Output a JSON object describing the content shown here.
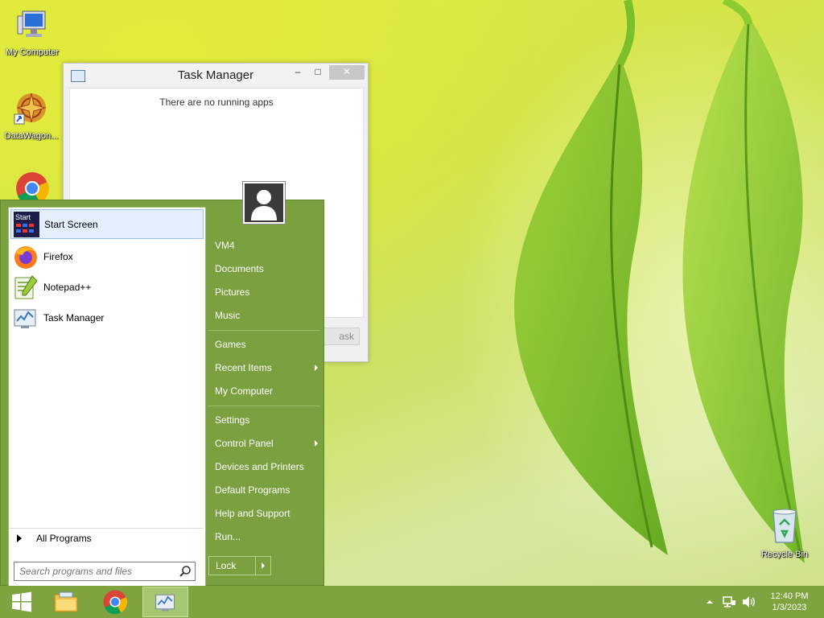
{
  "desktop": {
    "icons": [
      {
        "label": "My Computer",
        "icon": "my-computer-icon"
      },
      {
        "label": "DataWagon...",
        "icon": "datawagon-icon"
      },
      {
        "label": "Recycle Bin",
        "icon": "recycle-bin-icon"
      }
    ]
  },
  "task_manager": {
    "title": "Task Manager",
    "minimize": "–",
    "maximize": "□",
    "close": "✕",
    "empty_message": "There are no running apps",
    "end_task_label": "ask"
  },
  "start_menu": {
    "programs": [
      {
        "label": "Start Screen",
        "icon": "start-screen-icon",
        "badge": "Start"
      },
      {
        "label": "Firefox",
        "icon": "firefox-icon"
      },
      {
        "label": "Notepad++",
        "icon": "notepadpp-icon"
      },
      {
        "label": "Task Manager",
        "icon": "task-manager-icon"
      }
    ],
    "all_programs": "All Programs",
    "search_placeholder": "Search programs and files",
    "right_items": [
      {
        "label": "VM4"
      },
      {
        "label": "Documents"
      },
      {
        "label": "Pictures"
      },
      {
        "label": "Music"
      },
      {
        "label": "Games"
      },
      {
        "label": "Recent Items",
        "submenu": true
      },
      {
        "label": "My Computer"
      },
      {
        "label": "Settings"
      },
      {
        "label": "Control Panel",
        "submenu": true
      },
      {
        "label": "Devices and Printers"
      },
      {
        "label": "Default Programs"
      },
      {
        "label": "Help and Support"
      },
      {
        "label": "Run..."
      }
    ],
    "lock_label": "Lock"
  },
  "taskbar": {
    "buttons": [
      "windows-start-icon",
      "file-explorer-icon",
      "chrome-icon",
      "task-manager-icon"
    ],
    "tray_icons": [
      "show-hidden-icon",
      "network-icon",
      "volume-icon"
    ],
    "time": "12:40 PM",
    "date": "1/3/2023"
  },
  "colors": {
    "start_menu_bg": "#7aa040",
    "taskbar_bg": "#7ea33f",
    "selected_item_bg": "#e3effc"
  }
}
